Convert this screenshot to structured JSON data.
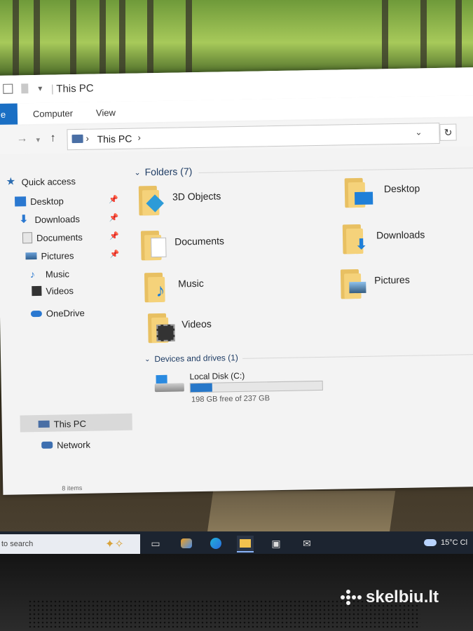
{
  "window": {
    "title": "This PC",
    "ribbon_tabs": [
      "e",
      "Computer",
      "View"
    ],
    "address": "This PC"
  },
  "sidebar": {
    "items": [
      {
        "label": "Quick access",
        "icon": "star-icon"
      },
      {
        "label": "Desktop",
        "icon": "desktop-icon",
        "pinned": true
      },
      {
        "label": "Downloads",
        "icon": "download-icon",
        "pinned": true
      },
      {
        "label": "Documents",
        "icon": "documents-icon",
        "pinned": true
      },
      {
        "label": "Pictures",
        "icon": "pictures-icon",
        "pinned": true
      },
      {
        "label": "Music",
        "icon": "music-icon"
      },
      {
        "label": "Videos",
        "icon": "videos-icon"
      },
      {
        "label": "OneDrive",
        "icon": "cloud-icon"
      },
      {
        "label": "This PC",
        "icon": "computer-icon",
        "selected": true
      },
      {
        "label": "Network",
        "icon": "network-icon"
      }
    ]
  },
  "folders_group": {
    "header": "Folders (7)",
    "items": [
      {
        "label": "3D Objects",
        "icon": "3d-objects-folder-icon"
      },
      {
        "label": "Desktop",
        "icon": "desktop-folder-icon"
      },
      {
        "label": "Documents",
        "icon": "documents-folder-icon"
      },
      {
        "label": "Downloads",
        "icon": "downloads-folder-icon"
      },
      {
        "label": "Music",
        "icon": "music-folder-icon"
      },
      {
        "label": "Pictures",
        "icon": "pictures-folder-icon"
      },
      {
        "label": "Videos",
        "icon": "videos-folder-icon"
      }
    ]
  },
  "drives_group": {
    "header": "Devices and drives (1)",
    "drive": {
      "label": "Local Disk (C:)",
      "free_text": "198 GB free of 237 GB",
      "used_fraction": 0.165
    }
  },
  "status_bar": {
    "items_count": "8 items"
  },
  "taskbar": {
    "search_placeholder": "to search",
    "weather": "15°C Cl"
  },
  "watermark": "skelbiu.lt",
  "colors": {
    "accent": "#1a6fc4",
    "folder": "#f5d27a",
    "drive_fill": "#2677c9",
    "taskbar": "#1c2430"
  }
}
